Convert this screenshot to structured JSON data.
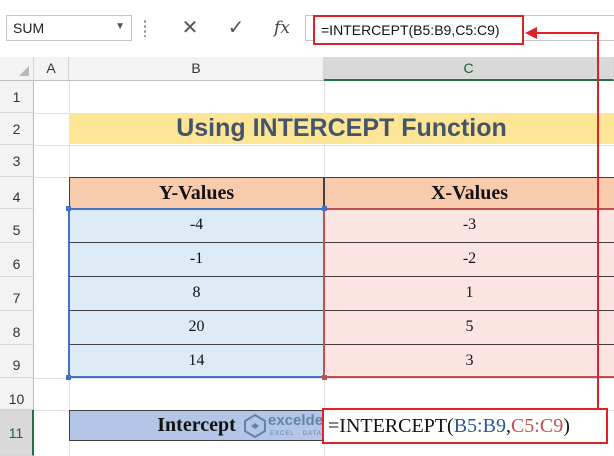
{
  "formula_bar": {
    "name_box": "SUM",
    "cancel_icon": "✕",
    "enter_icon": "✓",
    "fx_label": "fx",
    "formula": "=INTERCEPT(B5:B9,C5:C9)"
  },
  "columns": [
    "A",
    "B",
    "C"
  ],
  "rows": [
    "1",
    "2",
    "3",
    "4",
    "5",
    "6",
    "7",
    "8",
    "9",
    "10",
    "11"
  ],
  "sheet": {
    "title": "Using INTERCEPT Function",
    "header_y": "Y-Values",
    "header_x": "X-Values",
    "y_values": [
      "-4",
      "-1",
      "8",
      "20",
      "14"
    ],
    "x_values": [
      "-3",
      "-2",
      "1",
      "5",
      "3"
    ],
    "intercept_label": "Intercept",
    "intercept_formula": {
      "fn": "=INTERCEPT(",
      "ref_b": "B5:B9",
      "sep": ",",
      "ref_c": "C5:C9",
      "close": ")"
    }
  },
  "watermark": {
    "name": "exceldemy",
    "sub": "EXCEL · DATA · BI"
  },
  "colors": {
    "accent_red": "#e0212a",
    "title_fill": "#fde596",
    "header_fill": "#f8cbad",
    "y_fill": "#ddebf7",
    "x_fill": "#fbe4e2",
    "label_fill": "#b4c6e7"
  },
  "icons": [
    "dropdown-arrow-icon",
    "cancel-icon",
    "enter-icon",
    "fx-icon",
    "select-all-icon",
    "exceldemy-logo-icon"
  ]
}
